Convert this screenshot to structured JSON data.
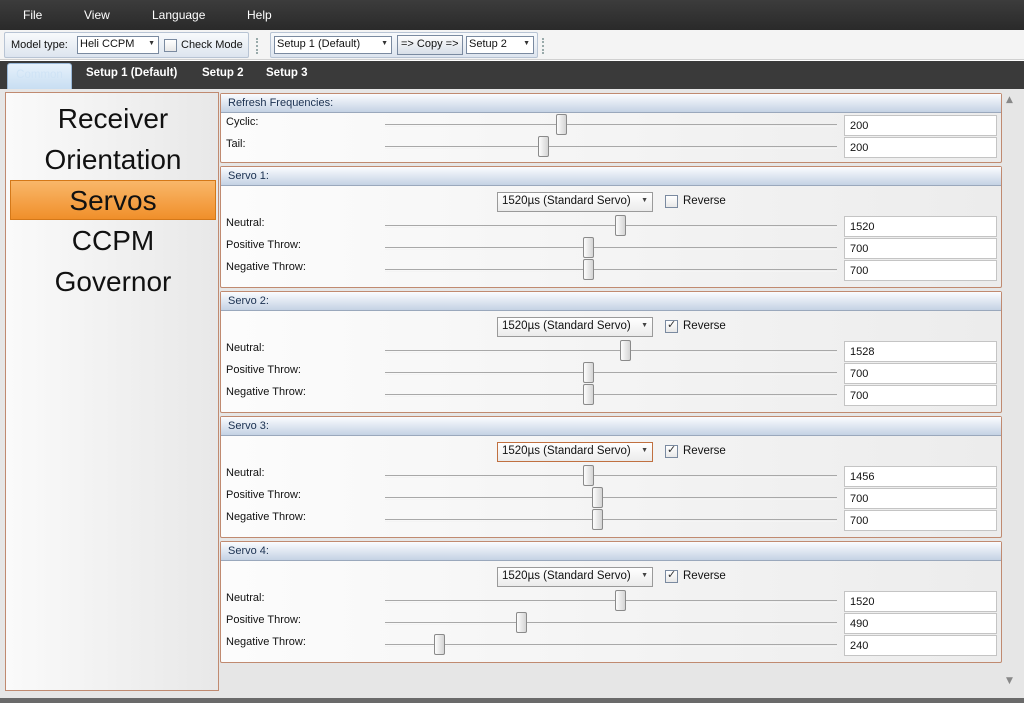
{
  "menu": {
    "file": "File",
    "view": "View",
    "language": "Language",
    "help": "Help"
  },
  "toolbar": {
    "model_type_label": "Model type:",
    "model_type_value": "Heli CCPM",
    "check_mode_label": "Check Mode",
    "check_mode_checked": false,
    "copy_source": "Setup 1 (Default)",
    "copy_button": "=> Copy =>",
    "copy_target": "Setup 2"
  },
  "tabs": [
    {
      "label": "Common",
      "active": true
    },
    {
      "label": "Setup 1 (Default)",
      "active": false
    },
    {
      "label": "Setup 2",
      "active": false
    },
    {
      "label": "Setup 3",
      "active": false
    }
  ],
  "sidebar": {
    "items": [
      {
        "label": "Receiver",
        "active": false
      },
      {
        "label": "Orientation",
        "active": false
      },
      {
        "label": "Servos",
        "active": true
      },
      {
        "label": "CCPM",
        "active": false
      },
      {
        "label": "Governor",
        "active": false
      }
    ]
  },
  "refresh": {
    "title": "Refresh Frequencies:",
    "cyclic_label": "Cyclic:",
    "cyclic_value": "200",
    "cyclic_level": 0.39,
    "tail_label": "Tail:",
    "tail_value": "200",
    "tail_level": 0.35
  },
  "servos": [
    {
      "title": "Servo 1:",
      "type": "1520µs (Standard Servo)",
      "reverse_label": "Reverse",
      "reverse": false,
      "neutral_label": "Neutral:",
      "neutral_value": "1520",
      "neutral_level": 0.52,
      "pos_label": "Positive Throw:",
      "pos_value": "700",
      "pos_level": 0.45,
      "neg_label": "Negative Throw:",
      "neg_value": "700",
      "neg_level": 0.45
    },
    {
      "title": "Servo 2:",
      "type": "1520µs (Standard Servo)",
      "reverse_label": "Reverse",
      "reverse": true,
      "neutral_label": "Neutral:",
      "neutral_value": "1528",
      "neutral_level": 0.53,
      "pos_label": "Positive Throw:",
      "pos_value": "700",
      "pos_level": 0.45,
      "neg_label": "Negative Throw:",
      "neg_value": "700",
      "neg_level": 0.45
    },
    {
      "title": "Servo 3:",
      "type": "1520µs (Standard Servo)",
      "reverse_label": "Reverse",
      "reverse": true,
      "neutral_label": "Neutral:",
      "neutral_value": "1456",
      "neutral_level": 0.45,
      "pos_label": "Positive Throw:",
      "pos_value": "700",
      "pos_level": 0.47,
      "neg_label": "Negative Throw:",
      "neg_value": "700",
      "neg_level": 0.47
    },
    {
      "title": "Servo 4:",
      "type": "1520µs (Standard Servo)",
      "reverse_label": "Reverse",
      "reverse": true,
      "neutral_label": "Neutral:",
      "neutral_value": "1520",
      "neutral_level": 0.52,
      "pos_label": "Positive Throw:",
      "pos_value": "490",
      "pos_level": 0.3,
      "neg_label": "Negative Throw:",
      "neg_value": "240",
      "neg_level": 0.12
    }
  ]
}
